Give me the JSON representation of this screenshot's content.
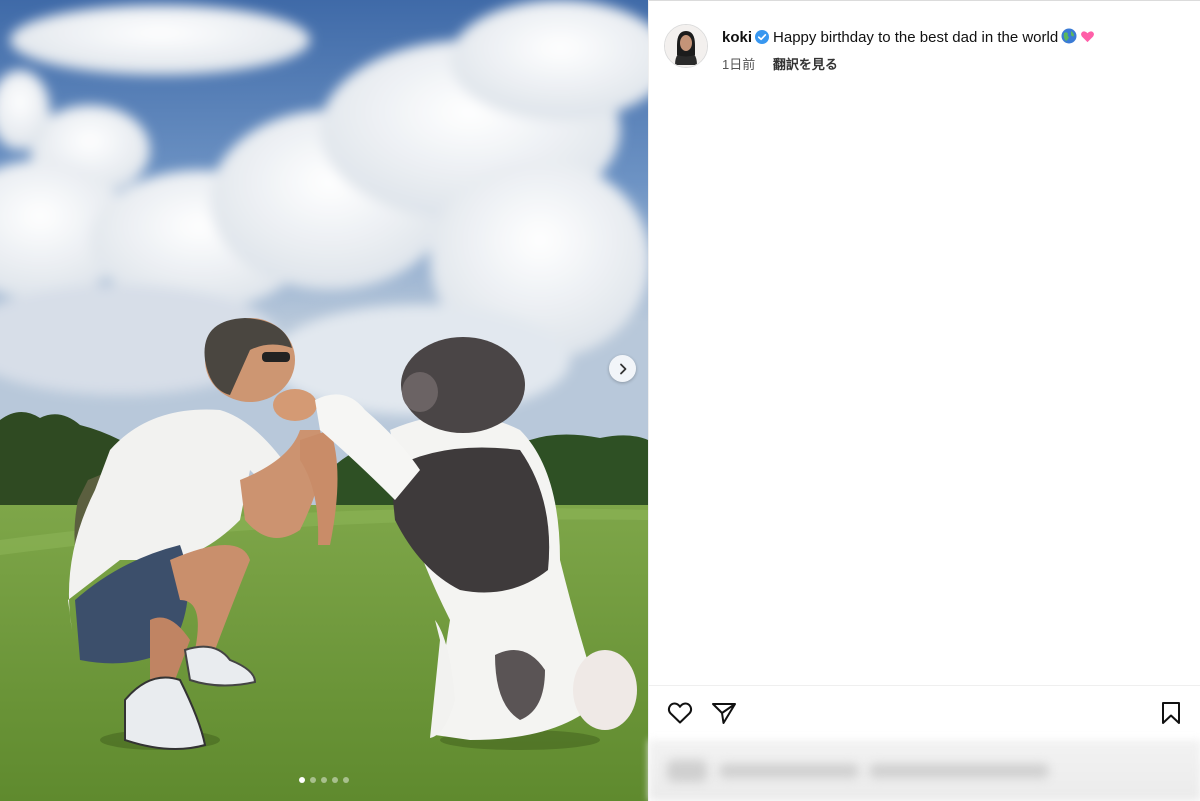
{
  "post": {
    "username": "koki",
    "caption": "Happy birthday to the best dad in the world",
    "caption_emoji": [
      "globe-icon",
      "pink-heart-icon"
    ],
    "time_ago": "1日前",
    "translate_label": "翻訳を見る"
  },
  "carousel": {
    "total_slides": 5,
    "current_slide": 1
  },
  "actions": [
    "like-icon",
    "share-icon",
    "save-icon"
  ],
  "colors": {
    "verified": "#3897f0",
    "heart_emoji": "#ff5fa8",
    "sky": "#4f79b5",
    "grass": "#6f9a3a"
  }
}
